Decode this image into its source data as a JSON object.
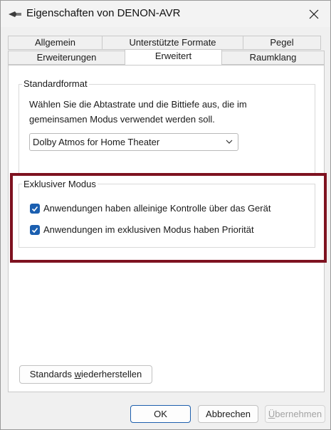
{
  "window": {
    "title": "Eigenschaften von DENON-AVR"
  },
  "tabs": {
    "row1": [
      {
        "label": "Allgemein"
      },
      {
        "label": "Unterstützte Formate"
      },
      {
        "label": "Pegel"
      }
    ],
    "row2": [
      {
        "label": "Erweiterungen"
      },
      {
        "label": "Erweitert"
      },
      {
        "label": "Raumklang"
      }
    ],
    "active": "Erweitert"
  },
  "standardformat": {
    "title": "Standardformat",
    "description_line1": "Wählen Sie die Abtastrate und die Bittiefe aus, die im",
    "description_line2": "gemeinsamen Modus verwendet werden soll.",
    "selected": "Dolby Atmos for Home Theater"
  },
  "exclusive": {
    "title": "Exklusiver Modus",
    "options": [
      {
        "label": "Anwendungen haben alleinige Kontrolle über das Gerät",
        "checked": true
      },
      {
        "label": "Anwendungen im exklusiven Modus haben Priorität",
        "checked": true
      }
    ]
  },
  "buttons": {
    "restore_prefix": "Standards ",
    "restore_mnemonic": "w",
    "restore_suffix": "iederherstellen",
    "ok": "OK",
    "cancel": "Abbrechen",
    "apply_mnemonic": "Ü",
    "apply_suffix": "bernehmen"
  },
  "colors": {
    "highlight": "#7e1220",
    "checkbox": "#1b5fb0",
    "primary_border": "#1d5fad"
  }
}
